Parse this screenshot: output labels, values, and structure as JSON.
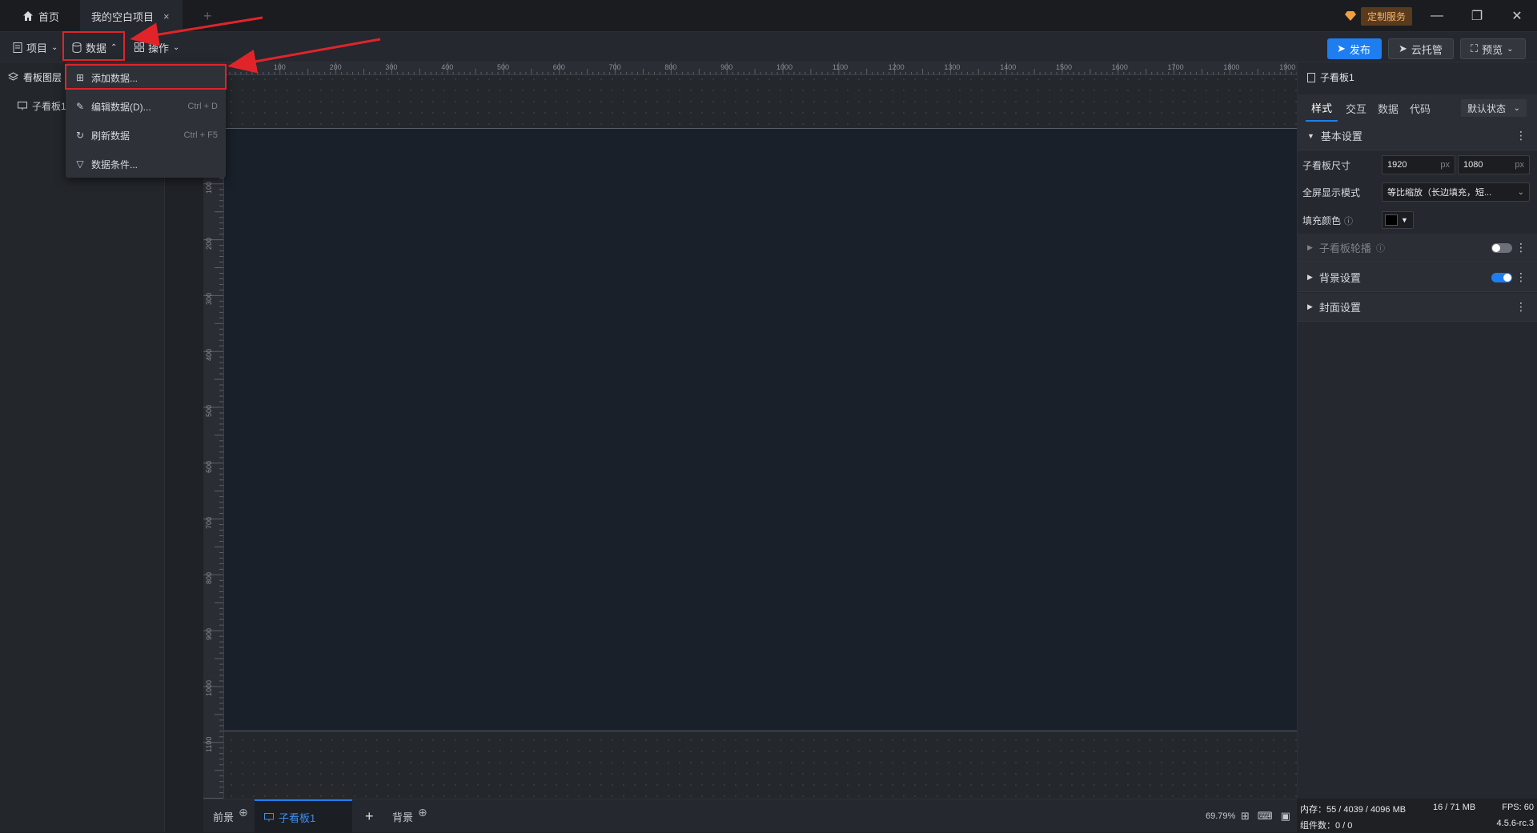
{
  "titlebar": {
    "home_tab": "首页",
    "project_tab": "我的空白项目",
    "close_glyph": "×",
    "new_tab_glyph": "+",
    "custom_service": "定制服务",
    "minimize": "—",
    "restore": "❐",
    "close": "✕"
  },
  "toolbar": {
    "project": "项目",
    "data": "数据",
    "operation": "操作",
    "publish": "发布",
    "cloud": "云托管",
    "preview": "预览"
  },
  "dropdown": {
    "items": [
      {
        "label": "添加数据...",
        "shortcut": ""
      },
      {
        "label": "编辑数据(D)...",
        "shortcut": "Ctrl + D"
      },
      {
        "label": "刷新数据",
        "shortcut": "Ctrl + F5"
      },
      {
        "label": "数据条件...",
        "shortcut": ""
      }
    ]
  },
  "leftpanel": {
    "header": "看板图层",
    "item": "子看板1"
  },
  "ruler": {
    "top_ticks": [
      "100",
      "200",
      "300",
      "400",
      "500",
      "600",
      "700",
      "800",
      "900",
      "1000",
      "1100",
      "1200",
      "1300",
      "1400",
      "1500",
      "1600",
      "1700",
      "1800",
      "1900"
    ],
    "left_ticks": [
      "100",
      "200",
      "300",
      "400",
      "500",
      "600",
      "700",
      "800",
      "900",
      "1000",
      "1100"
    ]
  },
  "bottombar": {
    "foreground": "前景",
    "board_tab": "子看板1",
    "add": "+",
    "background": "背景",
    "zoom": "69.79%"
  },
  "rightpanel": {
    "title": "子看板1",
    "tabs": [
      "样式",
      "交互",
      "数据",
      "代码"
    ],
    "state_select": "默认状态",
    "basic_settings": "基本设置",
    "size_label": "子看板尺寸",
    "width": "1920",
    "height": "1080",
    "unit": "px",
    "fullscreen_label": "全屏显示模式",
    "fullscreen_value": "等比缩放（长边填充，短...",
    "fill_label": "填充颜色",
    "carousel": "子看板轮播",
    "background_settings": "背景设置",
    "cover_settings": "封面设置",
    "colors": {
      "accent": "#1e7ef0",
      "fill": "#000000"
    }
  },
  "statusbar": {
    "memory": "内存：55 / 4039 / 4096 MB",
    "memory2": "16 / 71 MB",
    "fps": "FPS:  60",
    "components": "组件数：0 / 0",
    "version": "4.5.6-rc.3"
  }
}
